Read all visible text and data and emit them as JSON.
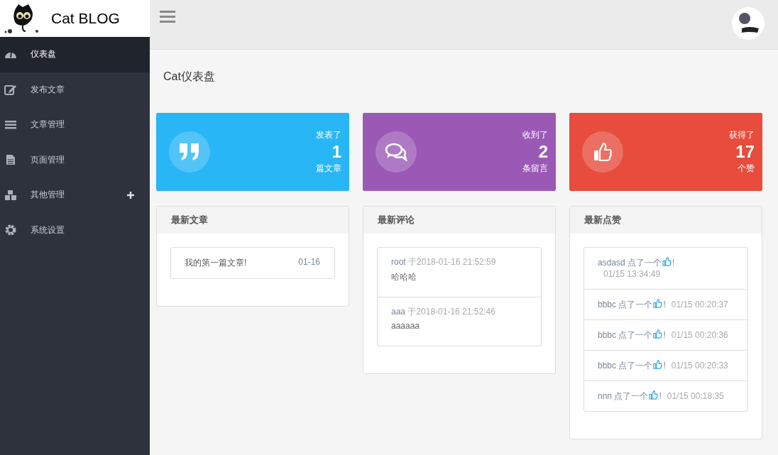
{
  "brand": {
    "title": "Cat BLOG"
  },
  "sidebar": {
    "items": [
      {
        "label": "仪表盘",
        "kind": "dashboard",
        "selected": true,
        "expandable": false
      },
      {
        "label": "发布文章",
        "kind": "edit",
        "selected": false,
        "expandable": false
      },
      {
        "label": "文章管理",
        "kind": "list",
        "selected": false,
        "expandable": false
      },
      {
        "label": "页面管理",
        "kind": "file",
        "selected": false,
        "expandable": false
      },
      {
        "label": "其他管理",
        "kind": "cubes",
        "selected": false,
        "expandable": true
      },
      {
        "label": "系统设置",
        "kind": "gear",
        "selected": false,
        "expandable": false
      }
    ]
  },
  "page_title": "Cat仪表盘",
  "stats": [
    {
      "kind": "quote",
      "color": "#29b6f6",
      "top": "发表了",
      "value": "1",
      "bottom": "篇文章"
    },
    {
      "kind": "comments",
      "color": "#9b59b6",
      "top": "收到了",
      "value": "2",
      "bottom": "条留言"
    },
    {
      "kind": "thumb",
      "color": "#e74c3c",
      "top": "获得了",
      "value": "17",
      "bottom": "个赞"
    }
  ],
  "articles": {
    "title": "最新文章",
    "items": [
      {
        "title": "我的第一篇文章!",
        "date": "01-16"
      }
    ]
  },
  "comments": {
    "title": "最新评论",
    "items": [
      {
        "user": "root",
        "time": "于2018-01-16 21:52:59",
        "text": "哈哈哈"
      },
      {
        "user": "aaa",
        "time": "于2018-01-16 21:52:46",
        "text": "aaaaaa"
      }
    ]
  },
  "likes": {
    "title": "最新点赞",
    "items": [
      {
        "user": "asdasd",
        "action": "点了一个",
        "suffix": "!",
        "time": "01/15 13:34:49"
      },
      {
        "user": "bbbc",
        "action": "点了一个",
        "suffix": "!",
        "time": "01/15 00:20:37"
      },
      {
        "user": "bbbc",
        "action": "点了一个",
        "suffix": "!",
        "time": "01/15 00:20:36"
      },
      {
        "user": "bbbc",
        "action": "点了一个",
        "suffix": "!",
        "time": "01/15 00:20:33"
      },
      {
        "user": "nnn",
        "action": "点了一个",
        "suffix": "!",
        "time": "01/15 00:18:35"
      }
    ]
  }
}
